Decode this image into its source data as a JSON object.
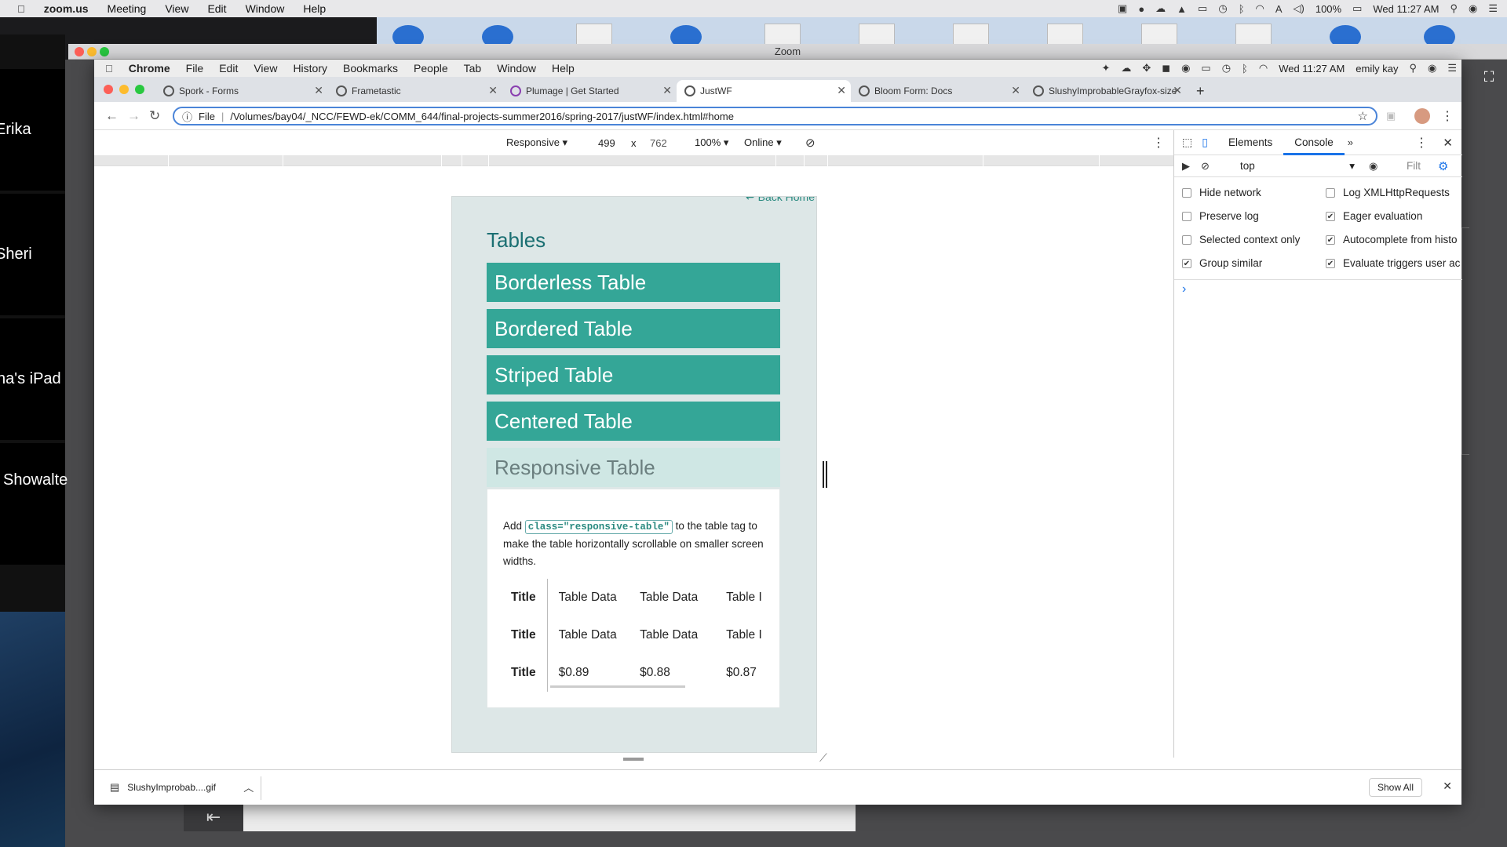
{
  "mac_menubar": {
    "app": "zoom.us",
    "items": [
      "Meeting",
      "View",
      "Edit",
      "Window",
      "Help"
    ],
    "battery": "100%",
    "clock": "Wed 11:27 AM"
  },
  "zoom_window": {
    "title": "Zoom",
    "participants": [
      "Erika",
      "Sheri",
      "na's iPad",
      "Showalte"
    ]
  },
  "chrome_menubar": {
    "app": "Chrome",
    "items": [
      "File",
      "Edit",
      "View",
      "History",
      "Bookmarks",
      "People",
      "Tab",
      "Window",
      "Help"
    ],
    "clock": "Wed 11:27 AM",
    "user": "emily kay"
  },
  "tabs": [
    {
      "label": "Spork - Forms"
    },
    {
      "label": "Frametastic"
    },
    {
      "label": "Plumage | Get Started"
    },
    {
      "label": "JustWF"
    },
    {
      "label": "Bloom Form: Docs"
    },
    {
      "label": "SlushyImprobableGrayfox-size"
    }
  ],
  "address": {
    "scheme": "File",
    "url": "/Volumes/bay04/_NCC/FEWD-ek/COMM_644/final-projects-summer2016/spring-2017/justWF/index.html#home"
  },
  "device_toolbar": {
    "mode": "Responsive",
    "width": "499",
    "times": "x",
    "height": "762",
    "zoom": "100%",
    "network": "Online"
  },
  "page": {
    "back_link": "Back Home",
    "heading": "Tables",
    "buttons": [
      "Borderless Table",
      "Bordered Table",
      "Striped Table",
      "Centered Table",
      "Responsive Table"
    ],
    "desc_before": "Add",
    "code": "class=\"responsive-table\"",
    "desc_after": "to the table tag to make the table horizontally scrollable on smaller screen widths.",
    "table": [
      [
        "Title",
        "Table Data",
        "Table Data",
        "Table I"
      ],
      [
        "Title",
        "Table Data",
        "Table Data",
        "Table I"
      ],
      [
        "Title",
        "$0.89",
        "$0.88",
        "$0.87"
      ]
    ]
  },
  "devtools": {
    "tabs": [
      "Elements",
      "Console"
    ],
    "context": "top",
    "filter": "Filt",
    "options_left": [
      {
        "label": "Hide network",
        "checked": false
      },
      {
        "label": "Preserve log",
        "checked": false
      },
      {
        "label": "Selected context only",
        "checked": false
      },
      {
        "label": "Group similar",
        "checked": true
      }
    ],
    "options_right": [
      {
        "label": "Log XMLHttpRequests",
        "checked": false
      },
      {
        "label": "Eager evaluation",
        "checked": true
      },
      {
        "label": "Autocomplete from histo",
        "checked": true
      },
      {
        "label": "Evaluate triggers user ac",
        "checked": true
      }
    ],
    "prompt": "›"
  },
  "download": {
    "file": "SlushyImprobab....gif",
    "show_all": "Show All"
  }
}
